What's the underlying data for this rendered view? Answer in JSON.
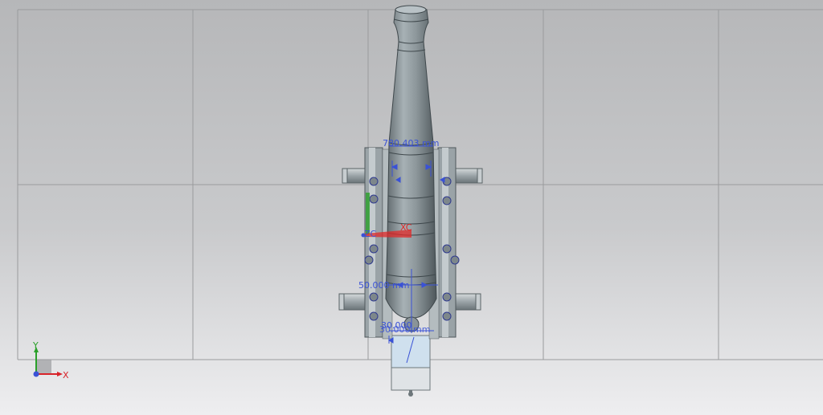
{
  "viewport": {
    "background_top": "#b6b7b9",
    "background_bottom": "#eeeef0",
    "grid_color": "#9a9b9d"
  },
  "model": {
    "metal_color": "#8e989c",
    "dimension_color": "#3a52d6",
    "dimensions": {
      "top": "780.403 mm",
      "middle": "50.000 mm",
      "bottom_1": "30.000",
      "bottom_2": "30.000 mm"
    },
    "wcs_labels": {
      "xc": "XC",
      "zc": "ZC"
    }
  },
  "triad": {
    "x": "X",
    "y": "Y",
    "x_color": "#d8232a",
    "y_color": "#2aa02a",
    "z_color": "#3a52d6"
  }
}
